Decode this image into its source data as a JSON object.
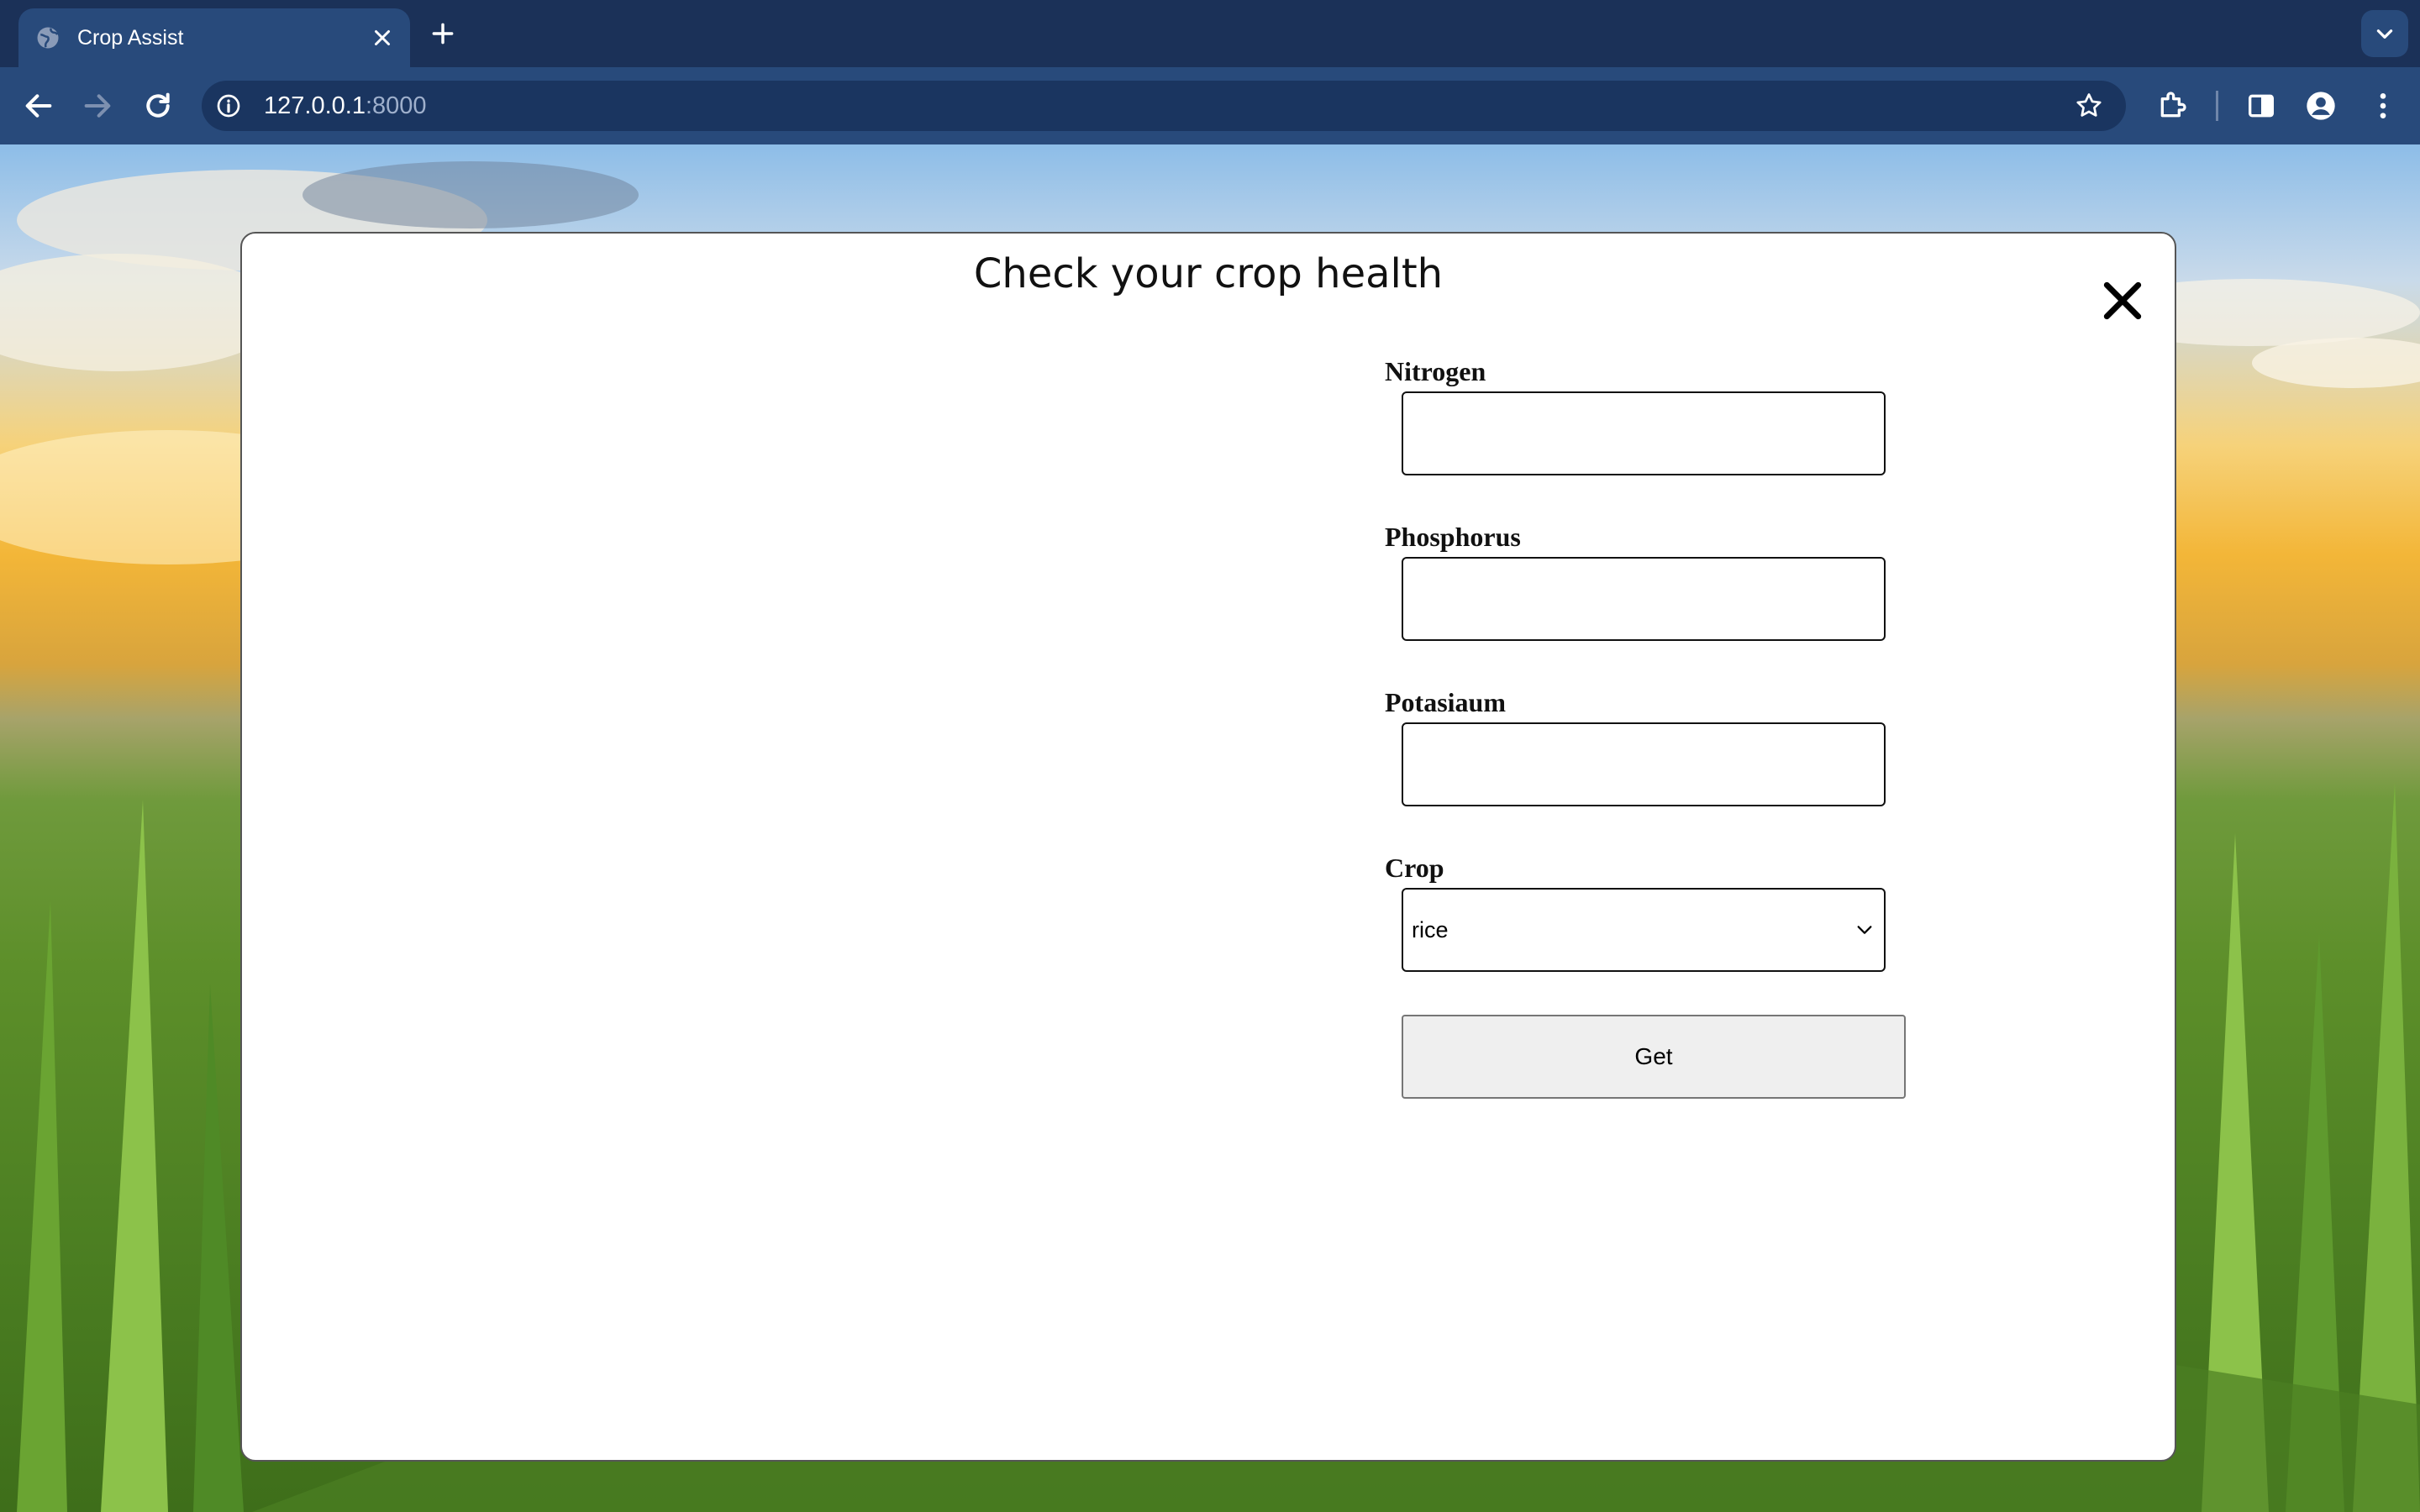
{
  "browser": {
    "tab": {
      "title": "Crop Assist",
      "favicon": "globe-icon"
    },
    "address": {
      "host": "127.0.0.1",
      "port": ":8000"
    }
  },
  "modal": {
    "title": "Check your crop health",
    "fields": [
      {
        "label": "Nitrogen",
        "value": ""
      },
      {
        "label": "Phosphorus",
        "value": ""
      },
      {
        "label": "Potasiaum",
        "value": ""
      }
    ],
    "crop": {
      "label": "Crop",
      "selected": "rice"
    },
    "submit_label": "Get"
  },
  "colors": {
    "tabstrip": "#1b3158",
    "toolbar": "#284a7b",
    "omnibox": "#1a3560",
    "modal_bg": "#ffffff",
    "button_bg": "#efefef"
  }
}
